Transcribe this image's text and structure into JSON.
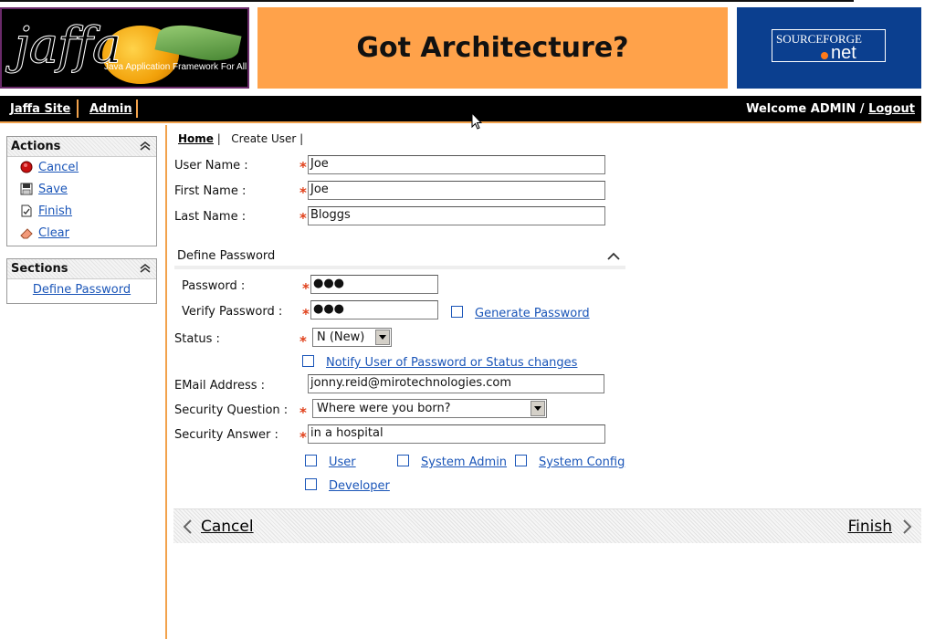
{
  "banner": {
    "logo_word": "jaffa",
    "logo_tagline": "Java Application Framework For All",
    "ad_text": "Got Architecture?",
    "sourceforge_top": "SOURCEFORGE",
    "sourceforge_bottom": "net"
  },
  "nav": {
    "jaffa_site": "Jaffa Site",
    "admin": "Admin",
    "welcome_prefix": "Welcome ADMIN / ",
    "logout": "Logout"
  },
  "sidebar": {
    "actions_title": "Actions",
    "actions": [
      {
        "label": "Cancel",
        "icon": "stop-icon"
      },
      {
        "label": "Save",
        "icon": "floppy-disk-icon"
      },
      {
        "label": "Finish",
        "icon": "document-check-icon"
      },
      {
        "label": "Clear",
        "icon": "eraser-icon"
      }
    ],
    "sections_title": "Sections",
    "sections": [
      "Define Password"
    ]
  },
  "breadcrumb": {
    "home": "Home",
    "sep1": "|",
    "current": "Create User",
    "sep2": "|"
  },
  "form": {
    "user_name_label": "User Name :",
    "user_name_value": "Joe",
    "first_name_label": "First Name :",
    "first_name_value": "Joe",
    "last_name_label": "Last Name :",
    "last_name_value": "Bloggs",
    "define_password_title": "Define Password",
    "password_label": "Password :",
    "password_value": "●●●",
    "verify_password_label": "Verify Password :",
    "verify_password_value": "●●●",
    "generate_password": "Generate Password",
    "status_label": "Status :",
    "status_value": "N (New)",
    "notify_label": "Notify User of Password or Status changes",
    "email_label": "EMail Address :",
    "email_value": "jonny.reid@mirotechnologies.com",
    "security_question_label": "Security Question :",
    "security_question_value": "Where were you born?",
    "security_answer_label": "Security Answer :",
    "security_answer_value": "in a hospital",
    "roles": [
      "User",
      "System Admin",
      "System Config",
      "Developer"
    ]
  },
  "footer": {
    "cancel": "Cancel",
    "finish": "Finish"
  },
  "colors": {
    "accent_orange": "#f2a24c",
    "ad_orange": "#ffa24a",
    "sourceforge_blue": "#0b3f8f",
    "link_blue": "#1a55b8",
    "required_red": "#e0401a"
  }
}
